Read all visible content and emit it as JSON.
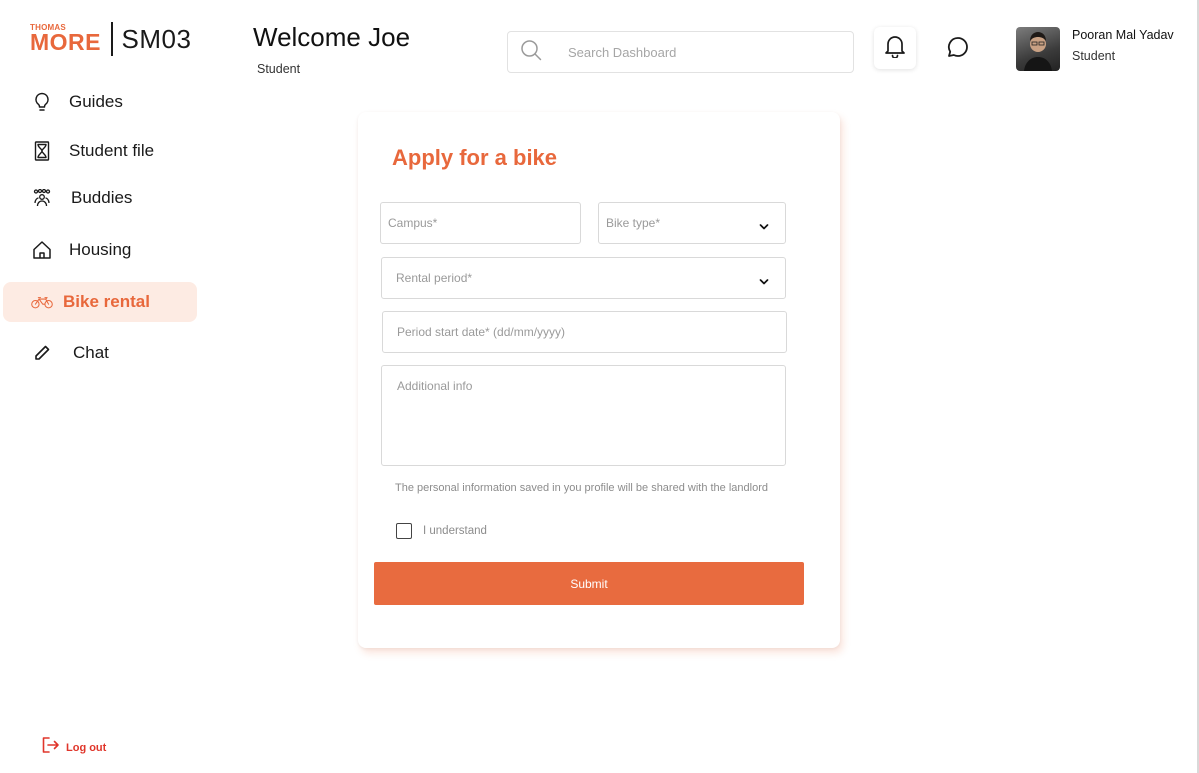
{
  "brand": {
    "logo_small": "THOMAS",
    "logo_big": "MORE",
    "code": "SM03",
    "accent": "#e8683c"
  },
  "sidebar": {
    "items": [
      {
        "label": "Guides",
        "icon": "lightbulb-icon"
      },
      {
        "label": "Student file",
        "icon": "hourglass-icon"
      },
      {
        "label": "Buddies",
        "icon": "group-icon"
      },
      {
        "label": "Housing",
        "icon": "house-icon"
      },
      {
        "label": "Bike rental",
        "icon": "bike-icon",
        "active": true
      },
      {
        "label": "Chat",
        "icon": "pencil-icon"
      }
    ],
    "logout_label": "Log out"
  },
  "header": {
    "welcome": "Welcome Joe",
    "role": "Student",
    "search_placeholder": "Search Dashboard"
  },
  "user": {
    "name": "Pooran Mal Yadav",
    "role": "Student"
  },
  "form": {
    "title": "Apply for a bike",
    "campus_placeholder": "Campus*",
    "bike_type_label": "Bike type*",
    "rental_period_label": "Rental period*",
    "start_date_placeholder": "Period start date* (dd/mm/yyyy)",
    "additional_info_placeholder": "Additional info",
    "notice": "The personal information saved in you profile will be shared with the landlord",
    "checkbox_label": "I understand",
    "submit_label": "Submit"
  }
}
